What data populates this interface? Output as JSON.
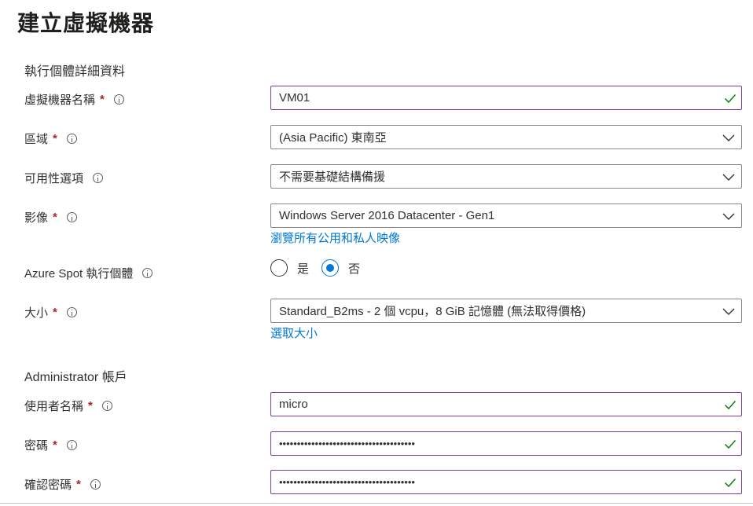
{
  "page_title": "建立虛擬機器",
  "instance_section": "執行個體詳細資料",
  "required_marker": "*",
  "fields": {
    "vm_name": {
      "label": "虛擬機器名稱",
      "value": "VM01"
    },
    "region": {
      "label": "區域",
      "value": "(Asia Pacific) 東南亞"
    },
    "availability": {
      "label": "可用性選項",
      "value": "不需要基礎結構備援"
    },
    "image": {
      "label": "影像",
      "value": "Windows Server 2016 Datacenter - Gen1",
      "link": "瀏覽所有公用和私人映像"
    },
    "spot": {
      "label": "Azure Spot 執行個體",
      "options": [
        "是",
        "否"
      ],
      "selected": "否"
    },
    "size": {
      "label": "大小",
      "value": "Standard_B2ms - 2 個 vcpu，8 GiB 記憶體 (無法取得價格)",
      "link": "選取大小"
    }
  },
  "admin_section": "Administrator 帳戶",
  "admin": {
    "username": {
      "label": "使用者名稱",
      "value": "micro"
    },
    "password": {
      "label": "密碼",
      "value": "••••••••••••••••••••••••••••••••••••••"
    },
    "confirm_password": {
      "label": "確認密碼",
      "value": "••••••••••••••••••••••••••••••••••••••"
    }
  },
  "colors": {
    "valid_border": "#7a3e9d",
    "check": "#107c10",
    "link": "#0078d4",
    "required": "#a4262c"
  },
  "icons": {
    "info": "info-icon",
    "check": "checkmark-icon",
    "dropdown": "chevron-down-icon"
  }
}
